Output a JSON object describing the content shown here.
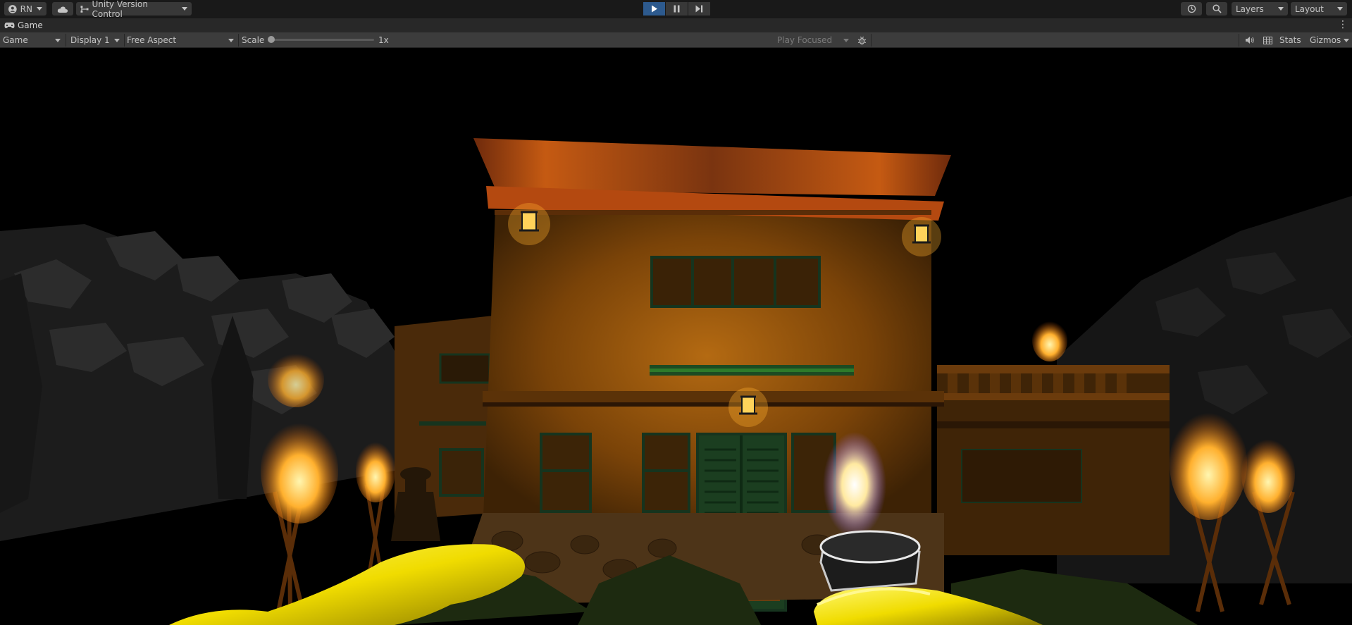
{
  "toolbar": {
    "account_label": "RN",
    "version_control_label": "Unity Version Control",
    "layers_label": "Layers",
    "layout_label": "Layout"
  },
  "tab": {
    "title": "Game"
  },
  "gamebar": {
    "view_select": "Game",
    "display_select": "Display 1",
    "aspect_select": "Free Aspect",
    "scale_label": "Scale",
    "scale_value": "1x",
    "play_focused": "Play Focused",
    "stats_label": "Stats",
    "gizmos_label": "Gizmos"
  },
  "colors": {
    "play_active": "#2d5a8e",
    "toolbar_bg": "#191919",
    "gamebar_bg": "#3c3c3c",
    "flashlight_glove": "#f5e600"
  },
  "icons": [
    "account-icon",
    "cloud-icon",
    "version-control-icon",
    "play-icon",
    "pause-icon",
    "step-icon",
    "history-icon",
    "search-icon",
    "gamepad-icon",
    "kebab-icon",
    "bug-icon",
    "audio-icon",
    "grid-icon"
  ]
}
